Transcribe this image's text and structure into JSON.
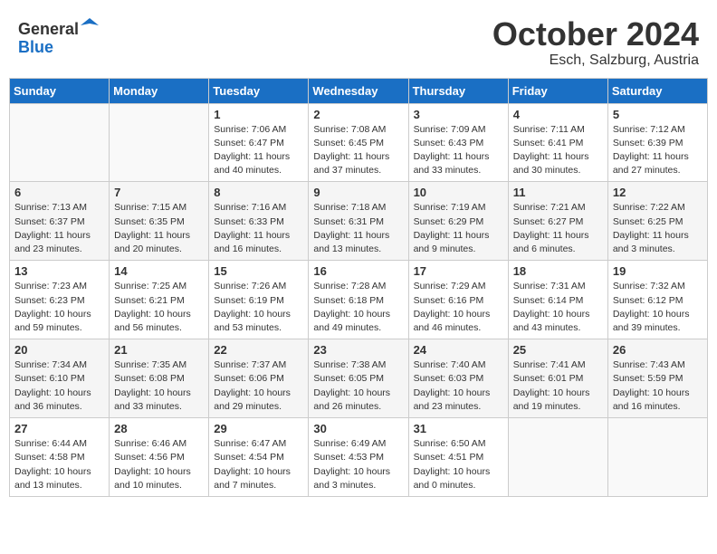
{
  "header": {
    "logo_line1": "General",
    "logo_line2": "Blue",
    "month": "October 2024",
    "location": "Esch, Salzburg, Austria"
  },
  "weekdays": [
    "Sunday",
    "Monday",
    "Tuesday",
    "Wednesday",
    "Thursday",
    "Friday",
    "Saturday"
  ],
  "weeks": [
    [
      {
        "day": "",
        "info": ""
      },
      {
        "day": "",
        "info": ""
      },
      {
        "day": "1",
        "info": "Sunrise: 7:06 AM\nSunset: 6:47 PM\nDaylight: 11 hours and 40 minutes."
      },
      {
        "day": "2",
        "info": "Sunrise: 7:08 AM\nSunset: 6:45 PM\nDaylight: 11 hours and 37 minutes."
      },
      {
        "day": "3",
        "info": "Sunrise: 7:09 AM\nSunset: 6:43 PM\nDaylight: 11 hours and 33 minutes."
      },
      {
        "day": "4",
        "info": "Sunrise: 7:11 AM\nSunset: 6:41 PM\nDaylight: 11 hours and 30 minutes."
      },
      {
        "day": "5",
        "info": "Sunrise: 7:12 AM\nSunset: 6:39 PM\nDaylight: 11 hours and 27 minutes."
      }
    ],
    [
      {
        "day": "6",
        "info": "Sunrise: 7:13 AM\nSunset: 6:37 PM\nDaylight: 11 hours and 23 minutes."
      },
      {
        "day": "7",
        "info": "Sunrise: 7:15 AM\nSunset: 6:35 PM\nDaylight: 11 hours and 20 minutes."
      },
      {
        "day": "8",
        "info": "Sunrise: 7:16 AM\nSunset: 6:33 PM\nDaylight: 11 hours and 16 minutes."
      },
      {
        "day": "9",
        "info": "Sunrise: 7:18 AM\nSunset: 6:31 PM\nDaylight: 11 hours and 13 minutes."
      },
      {
        "day": "10",
        "info": "Sunrise: 7:19 AM\nSunset: 6:29 PM\nDaylight: 11 hours and 9 minutes."
      },
      {
        "day": "11",
        "info": "Sunrise: 7:21 AM\nSunset: 6:27 PM\nDaylight: 11 hours and 6 minutes."
      },
      {
        "day": "12",
        "info": "Sunrise: 7:22 AM\nSunset: 6:25 PM\nDaylight: 11 hours and 3 minutes."
      }
    ],
    [
      {
        "day": "13",
        "info": "Sunrise: 7:23 AM\nSunset: 6:23 PM\nDaylight: 10 hours and 59 minutes."
      },
      {
        "day": "14",
        "info": "Sunrise: 7:25 AM\nSunset: 6:21 PM\nDaylight: 10 hours and 56 minutes."
      },
      {
        "day": "15",
        "info": "Sunrise: 7:26 AM\nSunset: 6:19 PM\nDaylight: 10 hours and 53 minutes."
      },
      {
        "day": "16",
        "info": "Sunrise: 7:28 AM\nSunset: 6:18 PM\nDaylight: 10 hours and 49 minutes."
      },
      {
        "day": "17",
        "info": "Sunrise: 7:29 AM\nSunset: 6:16 PM\nDaylight: 10 hours and 46 minutes."
      },
      {
        "day": "18",
        "info": "Sunrise: 7:31 AM\nSunset: 6:14 PM\nDaylight: 10 hours and 43 minutes."
      },
      {
        "day": "19",
        "info": "Sunrise: 7:32 AM\nSunset: 6:12 PM\nDaylight: 10 hours and 39 minutes."
      }
    ],
    [
      {
        "day": "20",
        "info": "Sunrise: 7:34 AM\nSunset: 6:10 PM\nDaylight: 10 hours and 36 minutes."
      },
      {
        "day": "21",
        "info": "Sunrise: 7:35 AM\nSunset: 6:08 PM\nDaylight: 10 hours and 33 minutes."
      },
      {
        "day": "22",
        "info": "Sunrise: 7:37 AM\nSunset: 6:06 PM\nDaylight: 10 hours and 29 minutes."
      },
      {
        "day": "23",
        "info": "Sunrise: 7:38 AM\nSunset: 6:05 PM\nDaylight: 10 hours and 26 minutes."
      },
      {
        "day": "24",
        "info": "Sunrise: 7:40 AM\nSunset: 6:03 PM\nDaylight: 10 hours and 23 minutes."
      },
      {
        "day": "25",
        "info": "Sunrise: 7:41 AM\nSunset: 6:01 PM\nDaylight: 10 hours and 19 minutes."
      },
      {
        "day": "26",
        "info": "Sunrise: 7:43 AM\nSunset: 5:59 PM\nDaylight: 10 hours and 16 minutes."
      }
    ],
    [
      {
        "day": "27",
        "info": "Sunrise: 6:44 AM\nSunset: 4:58 PM\nDaylight: 10 hours and 13 minutes."
      },
      {
        "day": "28",
        "info": "Sunrise: 6:46 AM\nSunset: 4:56 PM\nDaylight: 10 hours and 10 minutes."
      },
      {
        "day": "29",
        "info": "Sunrise: 6:47 AM\nSunset: 4:54 PM\nDaylight: 10 hours and 7 minutes."
      },
      {
        "day": "30",
        "info": "Sunrise: 6:49 AM\nSunset: 4:53 PM\nDaylight: 10 hours and 3 minutes."
      },
      {
        "day": "31",
        "info": "Sunrise: 6:50 AM\nSunset: 4:51 PM\nDaylight: 10 hours and 0 minutes."
      },
      {
        "day": "",
        "info": ""
      },
      {
        "day": "",
        "info": ""
      }
    ]
  ]
}
